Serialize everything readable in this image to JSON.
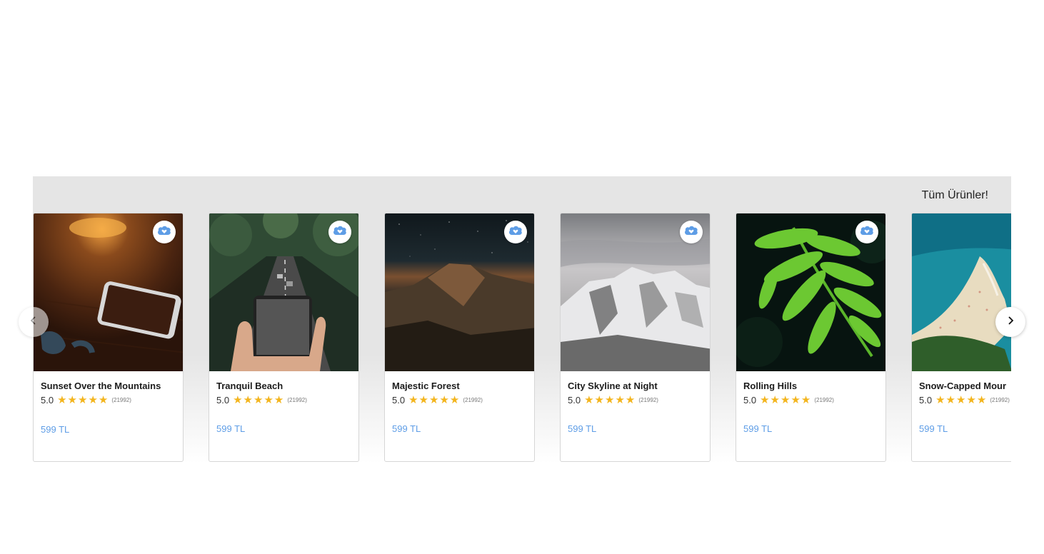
{
  "header": {
    "all_products_label": "Tüm Ürünler!"
  },
  "carousel": {
    "prev_icon": "chevron-left-icon",
    "next_icon": "chevron-right-icon",
    "products": [
      {
        "title": "Sunset Over the Mountains",
        "rating": "5.0",
        "stars": 5,
        "reviews": "(21992)",
        "price": "599 TL",
        "image": "phone-on-table"
      },
      {
        "title": "Tranquil Beach",
        "rating": "5.0",
        "stars": 5,
        "reviews": "(21992)",
        "price": "599 TL",
        "image": "hand-holding-phone-road"
      },
      {
        "title": "Majestic Forest",
        "rating": "5.0",
        "stars": 5,
        "reviews": "(21992)",
        "price": "599 TL",
        "image": "mountain-night-sky"
      },
      {
        "title": "City Skyline at Night",
        "rating": "5.0",
        "stars": 5,
        "reviews": "(21992)",
        "price": "599 TL",
        "image": "snowy-mountain"
      },
      {
        "title": "Rolling Hills",
        "rating": "5.0",
        "stars": 5,
        "reviews": "(21992)",
        "price": "599 TL",
        "image": "fern-leaf"
      },
      {
        "title": "Snow-Capped Mour",
        "rating": "5.0",
        "stars": 5,
        "reviews": "(21992)",
        "price": "599 TL",
        "image": "beach-aerial"
      }
    ]
  },
  "colors": {
    "accent": "#5e9de6",
    "star": "#f3b51e",
    "section_bg": "#e5e5e5"
  }
}
